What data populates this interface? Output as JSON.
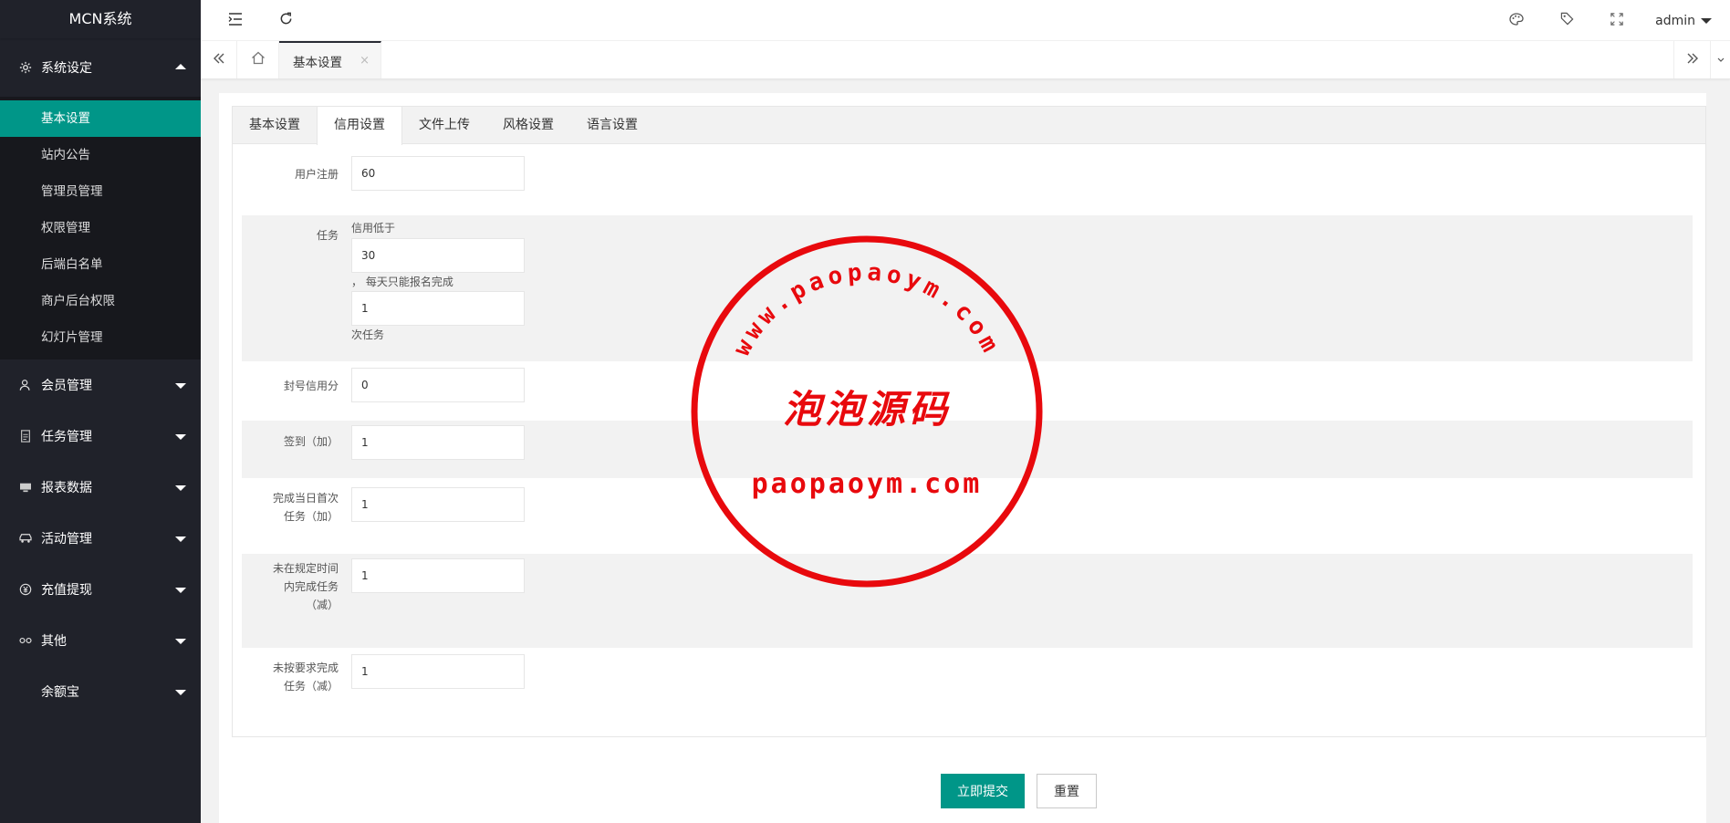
{
  "app": {
    "title": "MCN系统"
  },
  "sidebar": {
    "groups": [
      {
        "label": "系统设定",
        "icon": "gear-icon",
        "expanded": true,
        "items": [
          {
            "label": "基本设置",
            "active": true
          },
          {
            "label": "站内公告"
          },
          {
            "label": "管理员管理"
          },
          {
            "label": "权限管理"
          },
          {
            "label": "后端白名单"
          },
          {
            "label": "商户后台权限"
          },
          {
            "label": "幻灯片管理"
          }
        ]
      },
      {
        "label": "会员管理",
        "icon": "user-icon"
      },
      {
        "label": "任务管理",
        "icon": "document-icon"
      },
      {
        "label": "报表数据",
        "icon": "chart-icon"
      },
      {
        "label": "活动管理",
        "icon": "car-icon"
      },
      {
        "label": "充值提现",
        "icon": "yen-icon"
      },
      {
        "label": "其他",
        "icon": "link-icon"
      },
      {
        "label": "余额宝",
        "icon": ""
      }
    ]
  },
  "header": {
    "user": "admin"
  },
  "tabsbar": {
    "tab_label": "基本设置",
    "close": "×"
  },
  "card": {
    "tabs": [
      "基本设置",
      "信用设置",
      "文件上传",
      "风格设置",
      "语言设置"
    ],
    "active_tab": 1
  },
  "form": {
    "register": {
      "label": "用户注册",
      "value": "60"
    },
    "task": {
      "label": "任务",
      "note1": "信用低于",
      "value1": "30",
      "note2": "， 每天只能报名完成",
      "value2": "1",
      "note3": "次任务"
    },
    "ban": {
      "label": "封号信用分",
      "value": "0"
    },
    "signin": {
      "label": "签到（加）",
      "value": "1"
    },
    "first_task": {
      "label_line1": "完成当日首次",
      "label_line2": "任务（加）",
      "value": "1"
    },
    "overdue": {
      "label_line1": "未在规定时间",
      "label_line2": "内完成任务",
      "label_line3": "（减）",
      "value": "1"
    },
    "not_required": {
      "label_line1": "未按要求完成",
      "label_line2": "任务（减）",
      "value": "1"
    }
  },
  "buttons": {
    "submit": "立即提交",
    "reset": "重置"
  },
  "watermark": {
    "arc_text": "www.paopaoym.com",
    "center_text": "泡泡源码",
    "bottom_text": "paopaoym.com",
    "color": "#e8090d"
  },
  "colors": {
    "accent": "#009688",
    "sidebar": "#20222a",
    "sidebar_sub": "#17181d"
  }
}
